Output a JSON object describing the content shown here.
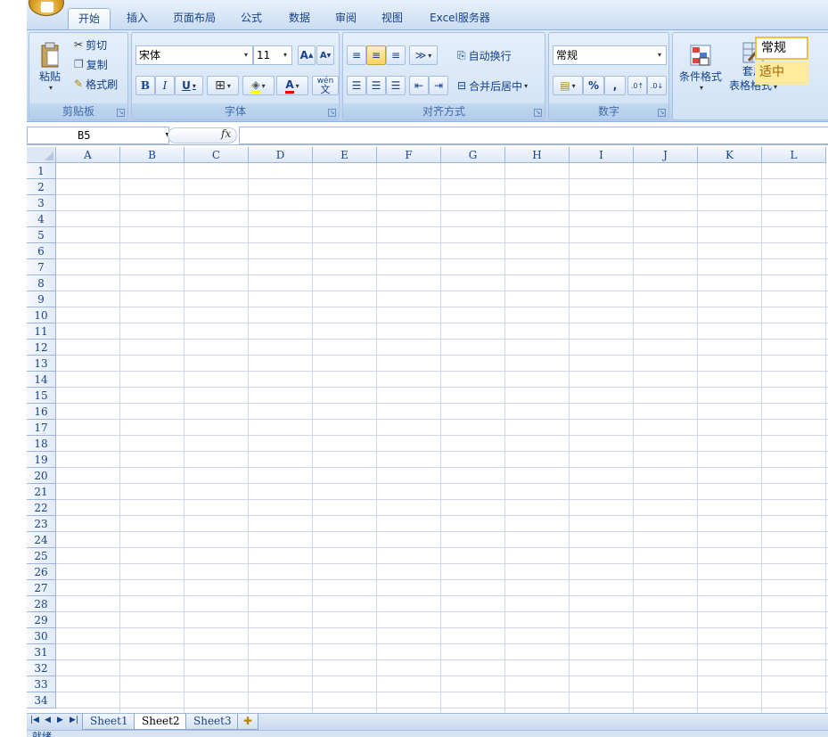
{
  "ribbon_tabs": [
    "开始",
    "插入",
    "页面布局",
    "公式",
    "数据",
    "审阅",
    "视图",
    "Excel服务器"
  ],
  "clipboard": {
    "paste": "粘贴",
    "cut": "剪切",
    "copy": "复制",
    "format_painter": "格式刷",
    "title": "剪贴板"
  },
  "font": {
    "name": "宋体",
    "size": "11",
    "grow": "A",
    "shrink": "A",
    "bold": "B",
    "italic": "I",
    "underline": "U",
    "font_color": "A",
    "phonetic": "wén",
    "title": "字体"
  },
  "alignment": {
    "wrap": "自动换行",
    "merge": "合并后居中",
    "title": "对齐方式"
  },
  "number": {
    "format": "常规",
    "percent": "%",
    "comma": ",",
    "title": "数字"
  },
  "styles": {
    "conditional": "条件格式",
    "table_fmt_1": "套用",
    "table_fmt_2": "表格格式",
    "style_normal": "常规",
    "style_neutral": "适中"
  },
  "formula_bar": {
    "name_box": "B5",
    "fx": "fx",
    "formula": ""
  },
  "columns": [
    "A",
    "B",
    "C",
    "D",
    "E",
    "F",
    "G",
    "H",
    "I",
    "J",
    "K",
    "L"
  ],
  "rows": [
    "1",
    "2",
    "3",
    "4",
    "5",
    "6",
    "7",
    "8",
    "9",
    "10",
    "11",
    "12",
    "13",
    "14",
    "15",
    "16",
    "17",
    "18",
    "19",
    "20",
    "21",
    "22",
    "23",
    "24",
    "25",
    "26",
    "27",
    "28",
    "29",
    "30",
    "31",
    "32",
    "33",
    "34"
  ],
  "sheets": [
    "Sheet1",
    "Sheet2",
    "Sheet3"
  ],
  "active_sheet": "Sheet2",
  "status": {
    "text": "就绪"
  }
}
